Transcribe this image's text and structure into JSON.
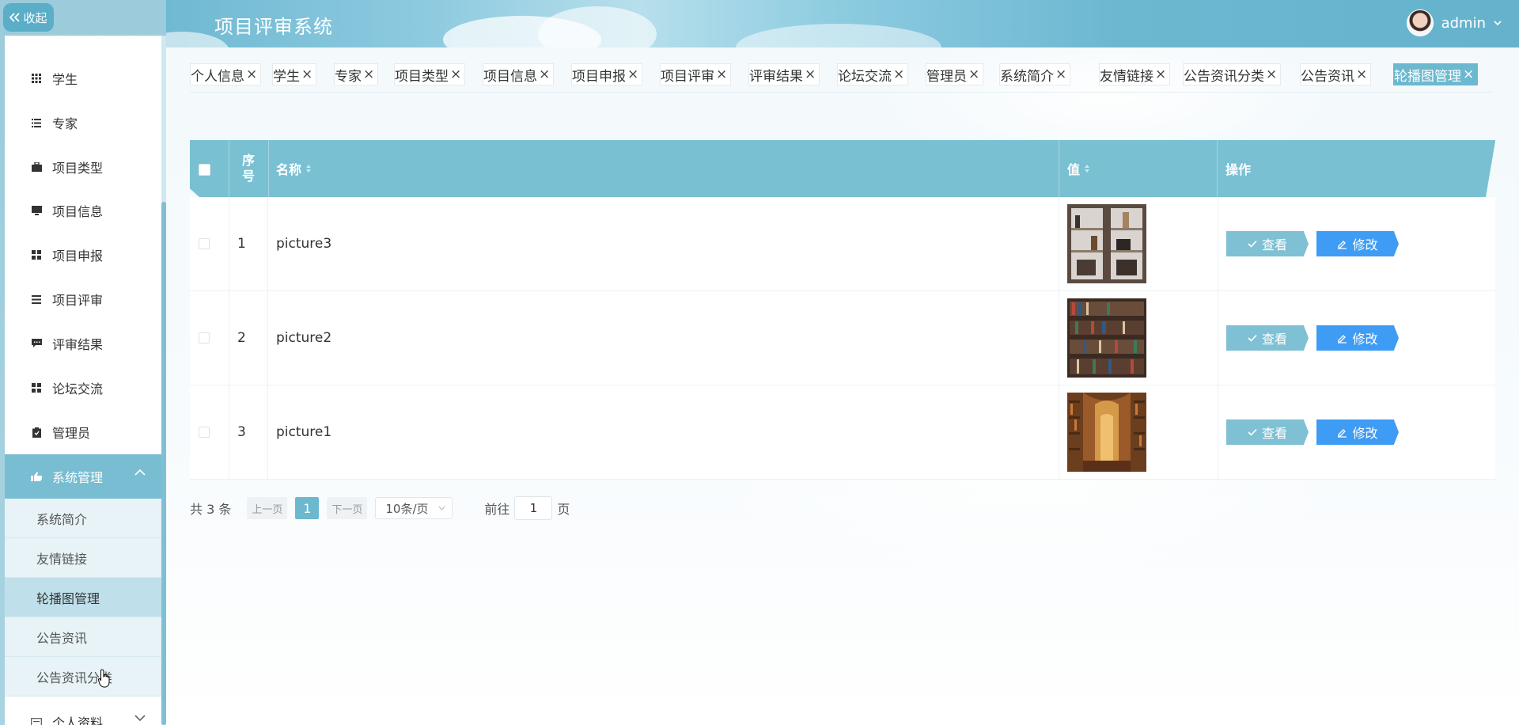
{
  "app": {
    "title": "项目评审系统"
  },
  "user": {
    "name": "admin"
  },
  "sidebar": {
    "collapse_label": "收起",
    "items": [
      {
        "label": "学生",
        "icon": "grid-icon"
      },
      {
        "label": "专家",
        "icon": "list-icon"
      },
      {
        "label": "项目类型",
        "icon": "briefcase-icon"
      },
      {
        "label": "项目信息",
        "icon": "monitor-icon"
      },
      {
        "label": "项目申报",
        "icon": "grid-icon"
      },
      {
        "label": "项目评审",
        "icon": "lines-icon"
      },
      {
        "label": "评审结果",
        "icon": "chat-icon"
      },
      {
        "label": "论坛交流",
        "icon": "grid-icon"
      },
      {
        "label": "管理员",
        "icon": "clipboard-icon"
      },
      {
        "label": "系统管理",
        "icon": "hand-icon"
      }
    ],
    "submenu": [
      {
        "label": "系统简介"
      },
      {
        "label": "友情链接"
      },
      {
        "label": "轮播图管理"
      },
      {
        "label": "公告资讯"
      },
      {
        "label": "公告资讯分类"
      }
    ],
    "bottom_item": {
      "label": "个人资料",
      "icon": "card-icon"
    }
  },
  "tabs": [
    {
      "label": "个人信息"
    },
    {
      "label": "学生"
    },
    {
      "label": "专家"
    },
    {
      "label": "项目类型"
    },
    {
      "label": "项目信息"
    },
    {
      "label": "项目申报"
    },
    {
      "label": "项目评审"
    },
    {
      "label": "评审结果"
    },
    {
      "label": "论坛交流"
    },
    {
      "label": "管理员"
    },
    {
      "label": "系统简介"
    },
    {
      "label": "友情链接"
    },
    {
      "label": "公告资讯分类"
    },
    {
      "label": "公告资讯"
    },
    {
      "label": "轮播图管理"
    }
  ],
  "tab_close": "×",
  "table": {
    "headers": {
      "index": "序号",
      "name": "名称",
      "value": "值",
      "actions": "操作"
    },
    "rows": [
      {
        "index": "1",
        "name": "picture3",
        "view": "查看",
        "edit": "修改"
      },
      {
        "index": "2",
        "name": "picture2",
        "view": "查看",
        "edit": "修改"
      },
      {
        "index": "3",
        "name": "picture1",
        "view": "查看",
        "edit": "修改"
      }
    ]
  },
  "pagination": {
    "total": "共 3 条",
    "prev": "上一页",
    "current": "1",
    "next": "下一页",
    "page_size": "10条/页",
    "goto_label": "前往",
    "goto_value": "1",
    "page_unit": "页"
  },
  "colors": {
    "accent": "#6cb9cf",
    "edit": "#3e9cf4",
    "view": "#7fc0d4"
  }
}
